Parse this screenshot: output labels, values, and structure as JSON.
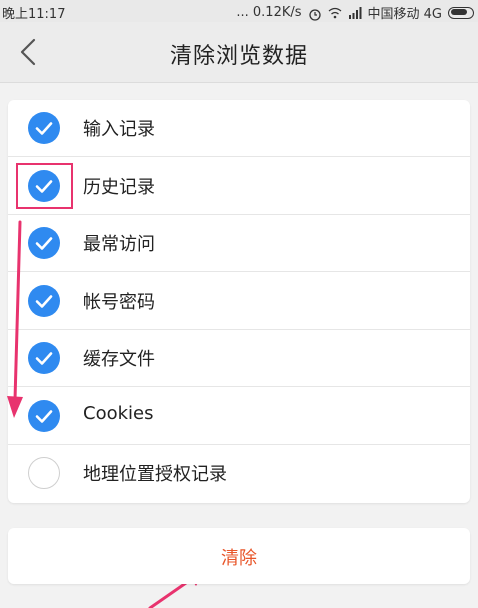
{
  "status_bar": {
    "time": "晚上11:17",
    "net_speed": "... 0.12K/s",
    "carrier": "中国移动 4G"
  },
  "nav": {
    "title": "清除浏览数据",
    "back_icon": "chevron-left-icon"
  },
  "options": [
    {
      "label": "输入记录",
      "checked": true
    },
    {
      "label": "历史记录",
      "checked": true
    },
    {
      "label": "最常访问",
      "checked": true
    },
    {
      "label": "帐号密码",
      "checked": true
    },
    {
      "label": "缓存文件",
      "checked": true
    },
    {
      "label": "Cookies",
      "checked": true
    },
    {
      "label": "地理位置授权记录",
      "checked": false
    }
  ],
  "clear_button": {
    "label": "清除"
  },
  "colors": {
    "accent": "#2f8af0",
    "clear_text": "#e8562a",
    "annotation": "#e8336e"
  }
}
